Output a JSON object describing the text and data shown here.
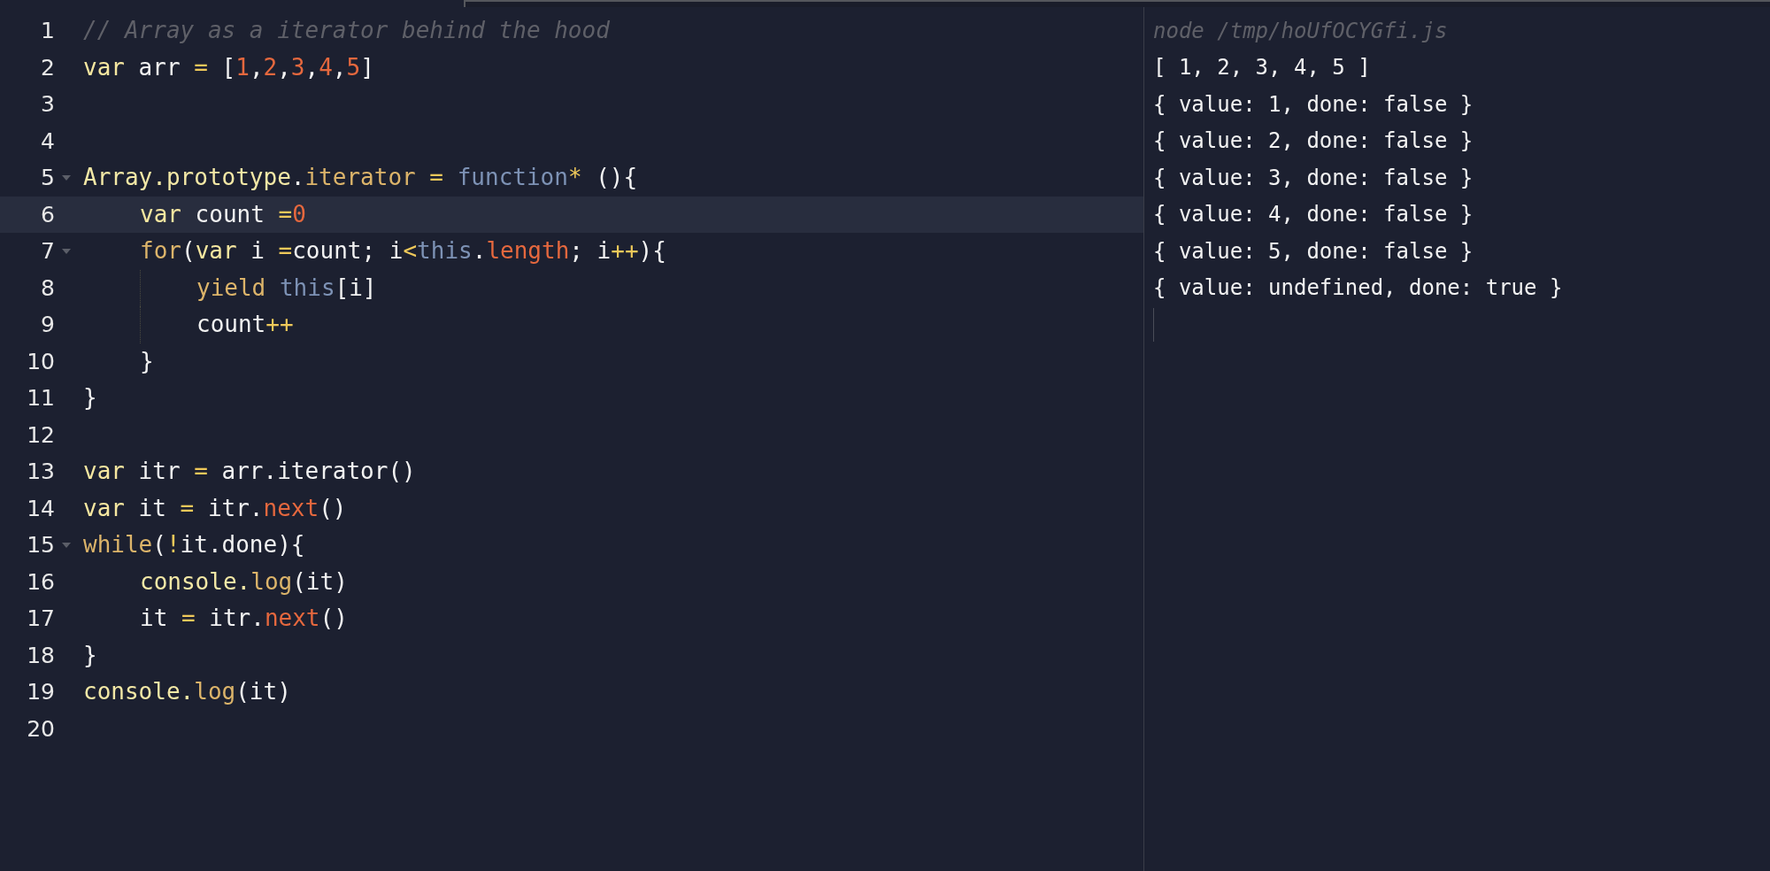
{
  "editor": {
    "lines": [
      {
        "number": "1",
        "foldable": false,
        "highlighted": false,
        "tokens": [
          {
            "text": "// Array as a iterator behind the hood",
            "kind": "comment"
          }
        ]
      },
      {
        "number": "2",
        "foldable": false,
        "highlighted": false,
        "tokens": [
          {
            "text": "var",
            "kind": "keyword"
          },
          {
            "text": " arr ",
            "kind": "plain"
          },
          {
            "text": "=",
            "kind": "operator"
          },
          {
            "text": " [",
            "kind": "plain"
          },
          {
            "text": "1",
            "kind": "number"
          },
          {
            "text": ",",
            "kind": "plain"
          },
          {
            "text": "2",
            "kind": "number"
          },
          {
            "text": ",",
            "kind": "plain"
          },
          {
            "text": "3",
            "kind": "number"
          },
          {
            "text": ",",
            "kind": "plain"
          },
          {
            "text": "4",
            "kind": "number"
          },
          {
            "text": ",",
            "kind": "plain"
          },
          {
            "text": "5",
            "kind": "number"
          },
          {
            "text": "]",
            "kind": "plain"
          }
        ]
      },
      {
        "number": "3",
        "foldable": false,
        "highlighted": false
      },
      {
        "number": "4",
        "foldable": false,
        "highlighted": false
      },
      {
        "number": "5",
        "foldable": true,
        "highlighted": false,
        "tokens": [
          {
            "text": "Array.prototype",
            "kind": "object"
          },
          {
            "text": ".",
            "kind": "plain"
          },
          {
            "text": "iterator",
            "kind": "property"
          },
          {
            "text": " = ",
            "kind": "operator"
          },
          {
            "text": "function",
            "kind": "builtin"
          },
          {
            "text": "*",
            "kind": "operator"
          },
          {
            "text": " (){",
            "kind": "plain"
          }
        ]
      },
      {
        "number": "6",
        "foldable": false,
        "highlighted": true,
        "tokens": [
          {
            "text": "    var",
            "kind": "keyword"
          },
          {
            "text": " count ",
            "kind": "plain"
          },
          {
            "text": "=",
            "kind": "operator"
          },
          {
            "text": "0",
            "kind": "number"
          }
        ]
      },
      {
        "number": "7",
        "foldable": true,
        "highlighted": false,
        "tokens": [
          {
            "text": "    for",
            "kind": "property"
          },
          {
            "text": "(",
            "kind": "plain"
          },
          {
            "text": "var",
            "kind": "keyword"
          },
          {
            "text": " i ",
            "kind": "plain"
          },
          {
            "text": "=",
            "kind": "operator"
          },
          {
            "text": "count; i",
            "kind": "plain"
          },
          {
            "text": "<",
            "kind": "operator"
          },
          {
            "text": "this",
            "kind": "builtin"
          },
          {
            "text": ".",
            "kind": "plain"
          },
          {
            "text": "length",
            "kind": "member"
          },
          {
            "text": "; i",
            "kind": "plain"
          },
          {
            "text": "++",
            "kind": "operator"
          },
          {
            "text": "){",
            "kind": "plain"
          }
        ]
      },
      {
        "number": "8",
        "foldable": false,
        "highlighted": false,
        "tokens": [
          {
            "text": "        yield",
            "kind": "property"
          },
          {
            "text": " this",
            "kind": "builtin"
          },
          {
            "text": "[i]",
            "kind": "plain"
          }
        ]
      },
      {
        "number": "9",
        "foldable": false,
        "highlighted": false,
        "tokens": [
          {
            "text": "        count",
            "kind": "plain"
          },
          {
            "text": "++",
            "kind": "operator"
          }
        ]
      },
      {
        "number": "10",
        "foldable": false,
        "highlighted": false,
        "tokens": [
          {
            "text": "    }",
            "kind": "plain"
          }
        ]
      },
      {
        "number": "11",
        "foldable": false,
        "highlighted": false,
        "tokens": [
          {
            "text": "}",
            "kind": "plain"
          }
        ]
      },
      {
        "number": "12",
        "foldable": false,
        "highlighted": false
      },
      {
        "number": "13",
        "foldable": false,
        "highlighted": false,
        "tokens": [
          {
            "text": "var",
            "kind": "keyword"
          },
          {
            "text": " itr ",
            "kind": "plain"
          },
          {
            "text": "=",
            "kind": "operator"
          },
          {
            "text": " arr.iterator()",
            "kind": "plain"
          }
        ]
      },
      {
        "number": "14",
        "foldable": false,
        "highlighted": false,
        "tokens": [
          {
            "text": "var",
            "kind": "keyword"
          },
          {
            "text": " it ",
            "kind": "plain"
          },
          {
            "text": "=",
            "kind": "operator"
          },
          {
            "text": " itr.",
            "kind": "plain"
          },
          {
            "text": "next",
            "kind": "member"
          },
          {
            "text": "()",
            "kind": "plain"
          }
        ]
      },
      {
        "number": "15",
        "foldable": true,
        "highlighted": false,
        "tokens": [
          {
            "text": "while",
            "kind": "property"
          },
          {
            "text": "(",
            "kind": "plain"
          },
          {
            "text": "!",
            "kind": "operator"
          },
          {
            "text": "it.done){",
            "kind": "plain"
          }
        ]
      },
      {
        "number": "16",
        "foldable": false,
        "highlighted": false,
        "tokens": [
          {
            "text": "    console.",
            "kind": "object"
          },
          {
            "text": "log",
            "kind": "property"
          },
          {
            "text": "(it)",
            "kind": "plain"
          }
        ]
      },
      {
        "number": "17",
        "foldable": false,
        "highlighted": false,
        "tokens": [
          {
            "text": "    it ",
            "kind": "plain"
          },
          {
            "text": "=",
            "kind": "operator"
          },
          {
            "text": " itr.",
            "kind": "plain"
          },
          {
            "text": "next",
            "kind": "member"
          },
          {
            "text": "()",
            "kind": "plain"
          }
        ]
      },
      {
        "number": "18",
        "foldable": false,
        "highlighted": false,
        "tokens": [
          {
            "text": "}",
            "kind": "plain"
          }
        ]
      },
      {
        "number": "19",
        "foldable": false,
        "highlighted": false,
        "tokens": [
          {
            "text": "console.",
            "kind": "object"
          },
          {
            "text": "log",
            "kind": "property"
          },
          {
            "text": "(it)",
            "kind": "plain"
          }
        ]
      },
      {
        "number": "20",
        "foldable": false,
        "highlighted": false
      }
    ]
  },
  "output": {
    "command": "node /tmp/hoUfOCYGfi.js",
    "lines": [
      "[ 1, 2, 3, 4, 5 ]",
      "{ value: 1, done: false }",
      "{ value: 2, done: false }",
      "{ value: 3, done: false }",
      "{ value: 4, done: false }",
      "{ value: 5, done: false }",
      "{ value: undefined, done: true }"
    ]
  }
}
